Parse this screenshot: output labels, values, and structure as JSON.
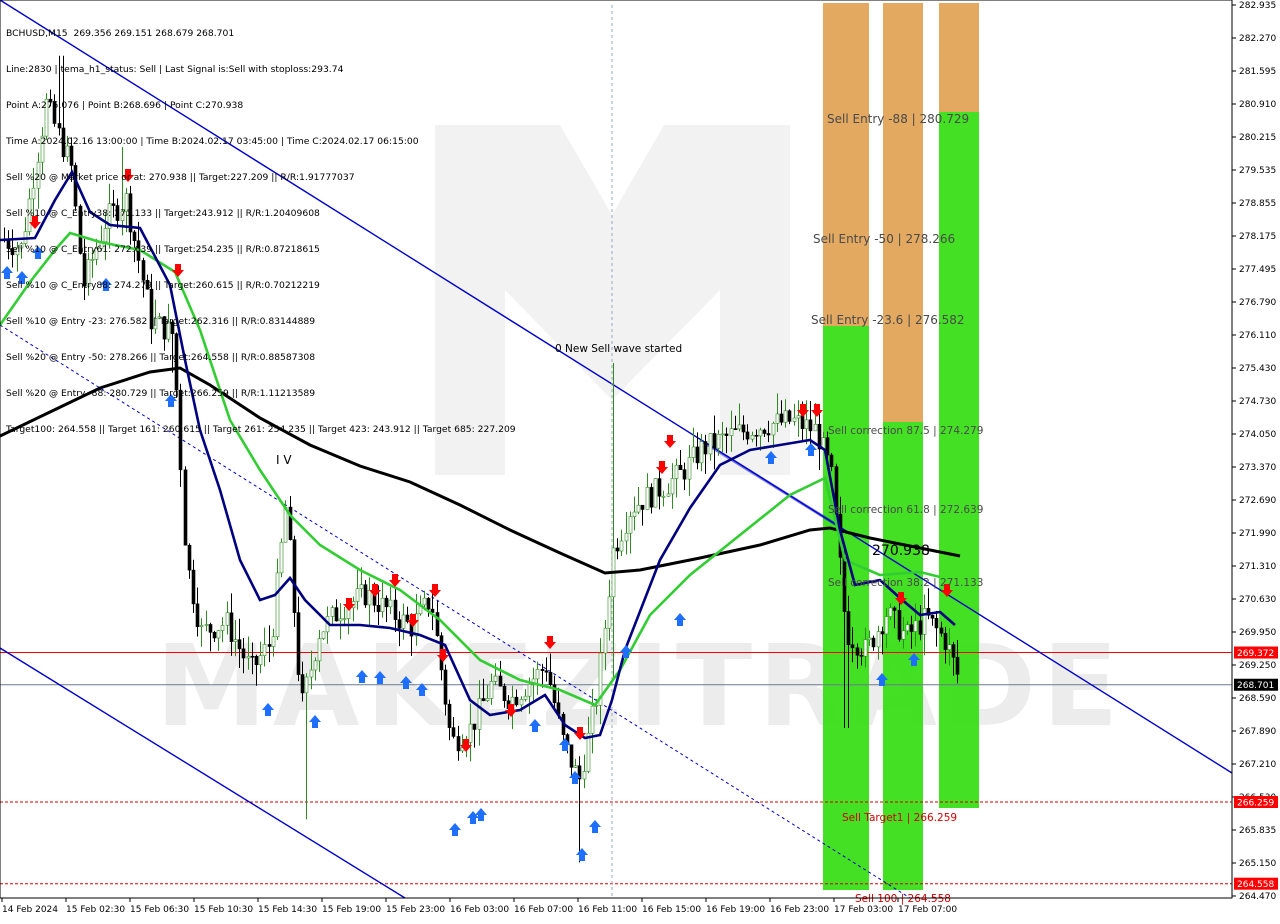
{
  "chart_data": {
    "type": "candlestick",
    "symbol_header": "BCHUSD,M15  269.356 269.151 268.679 268.701",
    "watermark_text": "MAKEZITRADE",
    "info_lines": [
      "Line:2830 | tema_h1_status: Sell | Last Signal is:Sell with stoploss:293.74",
      "Point A:275.076 | Point B:268.696 | Point C:270.938",
      "Time A:2024.02.16 13:00:00 | Time B:2024.02.17 03:45:00 | Time C:2024.02.17 06:15:00",
      "Sell %20 @ Market price or at: 270.938 || Target:227.209 || R/R:1.91777037",
      "Sell %10 @ C_Entry38: 271.133 || Target:243.912 || R/R:1.20409608",
      "Sell %10 @ C_Entry61: 272.639 || Target:254.235 || R/R:0.87218615",
      "Sell %10 @ C_Entry88: 274.279 || Target:260.615 || R/R:0.70212219",
      "Sell %10 @ Entry -23: 276.582 || Target:262.316 || R/R:0.83144889",
      "Sell %20 @ Entry -50: 278.266 || Target:264.558 || R/R:0.88587308",
      "Sell %20 @ Entry -88: 280.729 || Target:266.259 || R/R:1.11213589",
      "Target100: 264.558 || Target 161: 260.615 || Target 261: 254.235 || Target 423: 243.912 || Target 685: 227.209"
    ],
    "y_axis": {
      "min": 264.26,
      "max": 282.96,
      "ticks": [
        "282.935",
        "282.270",
        "281.595",
        "280.910",
        "280.215",
        "279.535",
        "278.855",
        "278.175",
        "277.495",
        "276.790",
        "276.110",
        "275.430",
        "274.730",
        "274.050",
        "273.370",
        "272.690",
        "271.990",
        "271.310",
        "270.630",
        "269.950",
        "269.250",
        "268.590",
        "267.890",
        "267.210",
        "266.530",
        "265.835",
        "265.150",
        "264.470"
      ]
    },
    "x_axis": {
      "labels": [
        "14 Feb 2024",
        "15 Feb 02:30",
        "15 Feb 06:30",
        "15 Feb 10:30",
        "15 Feb 14:30",
        "15 Feb 19:00",
        "15 Feb 23:00",
        "16 Feb 03:00",
        "16 Feb 07:00",
        "16 Feb 11:00",
        "16 Feb 15:00",
        "16 Feb 19:00",
        "16 Feb 23:00",
        "17 Feb 03:00",
        "17 Feb 07:00"
      ]
    },
    "price_tags": [
      {
        "value": 269.372,
        "label": "269.372",
        "bg": "#ff0000",
        "fg": "#ffffff",
        "line": "#ff0000",
        "style": "solid"
      },
      {
        "value": 268.701,
        "label": "268.701",
        "bg": "#000000",
        "fg": "#ffffff",
        "line": "#6b7a8f",
        "style": "solid"
      },
      {
        "value": 266.259,
        "label": "266.259",
        "bg": "#ff0000",
        "fg": "#ffffff",
        "line": "#d40000",
        "style": "dashed"
      },
      {
        "value": 264.558,
        "label": "264.558",
        "bg": "#ff0000",
        "fg": "#ffffff",
        "line": "#d40000",
        "style": "dashed"
      }
    ],
    "level_labels": [
      {
        "text": "Sell Entry -88 | 280.729",
        "color": "#4a4a4a",
        "value": 280.729
      },
      {
        "text": "Sell Entry -50 | 278.266",
        "color": "#4a4a4a",
        "value": 278.266
      },
      {
        "text": "Sell Entry -23.6 | 276.582",
        "color": "#4a4a4a",
        "value": 276.582
      },
      {
        "text": "Sell correction 87.5 | 274.279",
        "color": "#4a4a4a",
        "value": 274.279
      },
      {
        "text": "Sell correction 61.8 | 272.639",
        "color": "#4a4a4a",
        "value": 272.639
      },
      {
        "text": "Sell correction 38.2 | 271.133",
        "color": "#4a4a4a",
        "value": 271.133
      },
      {
        "text": "Sell Target1 | 266.259",
        "color": "#d40000",
        "value": 266.259
      },
      {
        "text": "Sell 100 | 264.558",
        "color": "#d40000",
        "value": 264.558
      }
    ],
    "annotations": [
      {
        "text": "0 New Sell wave started",
        "color": "#000000"
      },
      {
        "text": "270.938",
        "color": "#000000"
      },
      {
        "text": "I V",
        "color": "#000000"
      }
    ],
    "ema_black_label": "",
    "colors": {
      "bull_candle": "#2e8b22",
      "bear_candle": "#000000",
      "ema_green": "#32cd32",
      "ema_blue": "#000080",
      "ema_black": "#000000",
      "channel": "#0000cd",
      "zone_green": "#33dd11",
      "zone_orange": "#e0a050",
      "sell_arrow": "#ff0000",
      "buy_arrow": "#1e6fff"
    }
  }
}
